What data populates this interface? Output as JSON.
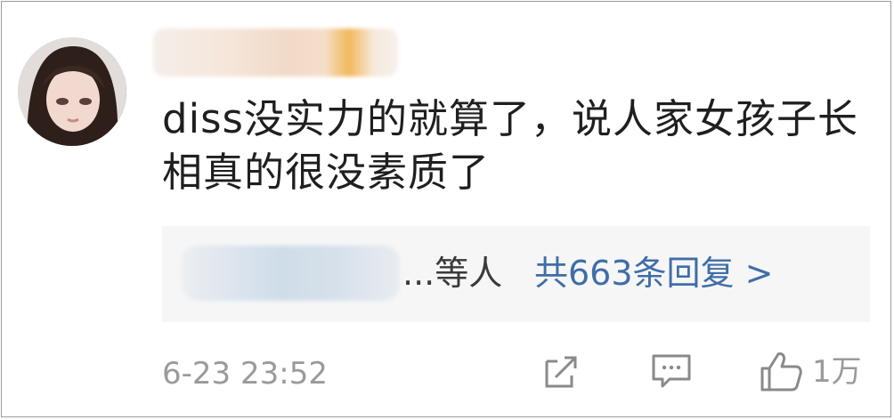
{
  "comment": {
    "text": "diss没实力的就算了，说人家女孩子长相真的很没素质了"
  },
  "replies": {
    "suffix": "...等人",
    "count_label": "共663条回复 >"
  },
  "footer": {
    "timestamp": "6-23 23:52",
    "like_count": "1万"
  },
  "icons": {
    "share": "share-icon",
    "comment": "comment-icon",
    "like": "thumbs-up-icon"
  },
  "colors": {
    "link": "#3f6ea8",
    "meta": "#9a9a9a",
    "text": "#1f1f1f",
    "reply_bg": "#f6f6f6"
  }
}
